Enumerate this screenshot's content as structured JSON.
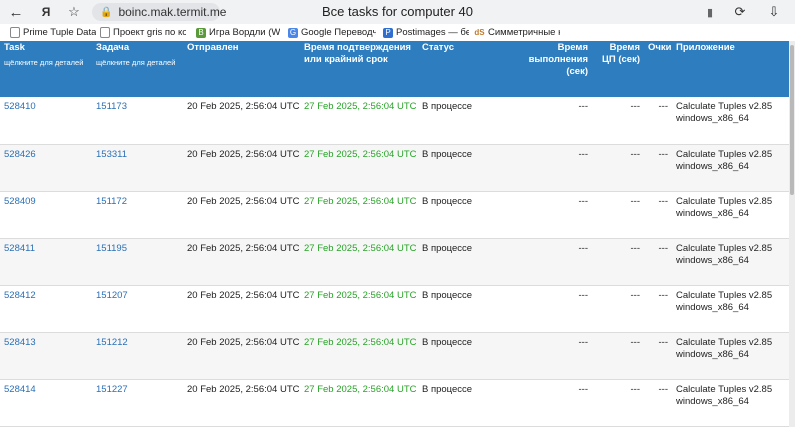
{
  "browser": {
    "url": "boinc.mak.termit.me",
    "title": "Все tasks for computer 40",
    "nav_back": "←",
    "yandex": "Я",
    "star": "☆",
    "reload": "⟳",
    "bookmark_icon": "▮",
    "download_icon": "⇩"
  },
  "bookmarks": [
    {
      "label": "Prime Tuple Datab",
      "icon": "document-icon"
    },
    {
      "label": "Проект gris по ко",
      "icon": "document-icon"
    },
    {
      "label": "Игра Вордли (Wo",
      "icon": "b-icon"
    },
    {
      "label": "Google Переводч",
      "icon": "translate-icon"
    },
    {
      "label": "Postimages — бес",
      "icon": "p-icon"
    },
    {
      "label": "Симметричные к",
      "icon": "ds-icon"
    }
  ],
  "table": {
    "headers": {
      "task": "Task",
      "task_sub": "щёлкните для деталей",
      "job": "Задача",
      "job_sub": "щёлкните для деталей",
      "sent": "Отправлен",
      "deadline": "Время подтверждения или крайний срок",
      "status": "Статус",
      "run_time": "Время выполнения (сек)",
      "cpu_time": "Время ЦП (сек)",
      "credit": "Очки",
      "app": "Приложение"
    },
    "rows": [
      {
        "task": "528410",
        "job": "151173",
        "sent": "20 Feb 2025, 2:56:04 UTC",
        "deadline": "27 Feb 2025, 2:56:04 UTC",
        "status": "В процессе",
        "run": "---",
        "cpu": "---",
        "credit": "---",
        "app": "Calculate Tuples v2.85 windows_x86_64"
      },
      {
        "task": "528426",
        "job": "153311",
        "sent": "20 Feb 2025, 2:56:04 UTC",
        "deadline": "27 Feb 2025, 2:56:04 UTC",
        "status": "В процессе",
        "run": "---",
        "cpu": "---",
        "credit": "---",
        "app": "Calculate Tuples v2.85 windows_x86_64"
      },
      {
        "task": "528409",
        "job": "151172",
        "sent": "20 Feb 2025, 2:56:04 UTC",
        "deadline": "27 Feb 2025, 2:56:04 UTC",
        "status": "В процессе",
        "run": "---",
        "cpu": "---",
        "credit": "---",
        "app": "Calculate Tuples v2.85 windows_x86_64"
      },
      {
        "task": "528411",
        "job": "151195",
        "sent": "20 Feb 2025, 2:56:04 UTC",
        "deadline": "27 Feb 2025, 2:56:04 UTC",
        "status": "В процессе",
        "run": "---",
        "cpu": "---",
        "credit": "---",
        "app": "Calculate Tuples v2.85 windows_x86_64"
      },
      {
        "task": "528412",
        "job": "151207",
        "sent": "20 Feb 2025, 2:56:04 UTC",
        "deadline": "27 Feb 2025, 2:56:04 UTC",
        "status": "В процессе",
        "run": "---",
        "cpu": "---",
        "credit": "---",
        "app": "Calculate Tuples v2.85 windows_x86_64"
      },
      {
        "task": "528413",
        "job": "151212",
        "sent": "20 Feb 2025, 2:56:04 UTC",
        "deadline": "27 Feb 2025, 2:56:04 UTC",
        "status": "В процессе",
        "run": "---",
        "cpu": "---",
        "credit": "---",
        "app": "Calculate Tuples v2.85 windows_x86_64"
      },
      {
        "task": "528414",
        "job": "151227",
        "sent": "20 Feb 2025, 2:56:04 UTC",
        "deadline": "27 Feb 2025, 2:56:04 UTC",
        "status": "В процессе",
        "run": "---",
        "cpu": "---",
        "credit": "---",
        "app": "Calculate Tuples v2.85 windows_x86_64"
      }
    ]
  },
  "colors": {
    "header_bg": "#2d7dbf",
    "link": "#2a6fb5",
    "deadline_green": "#27a327"
  }
}
